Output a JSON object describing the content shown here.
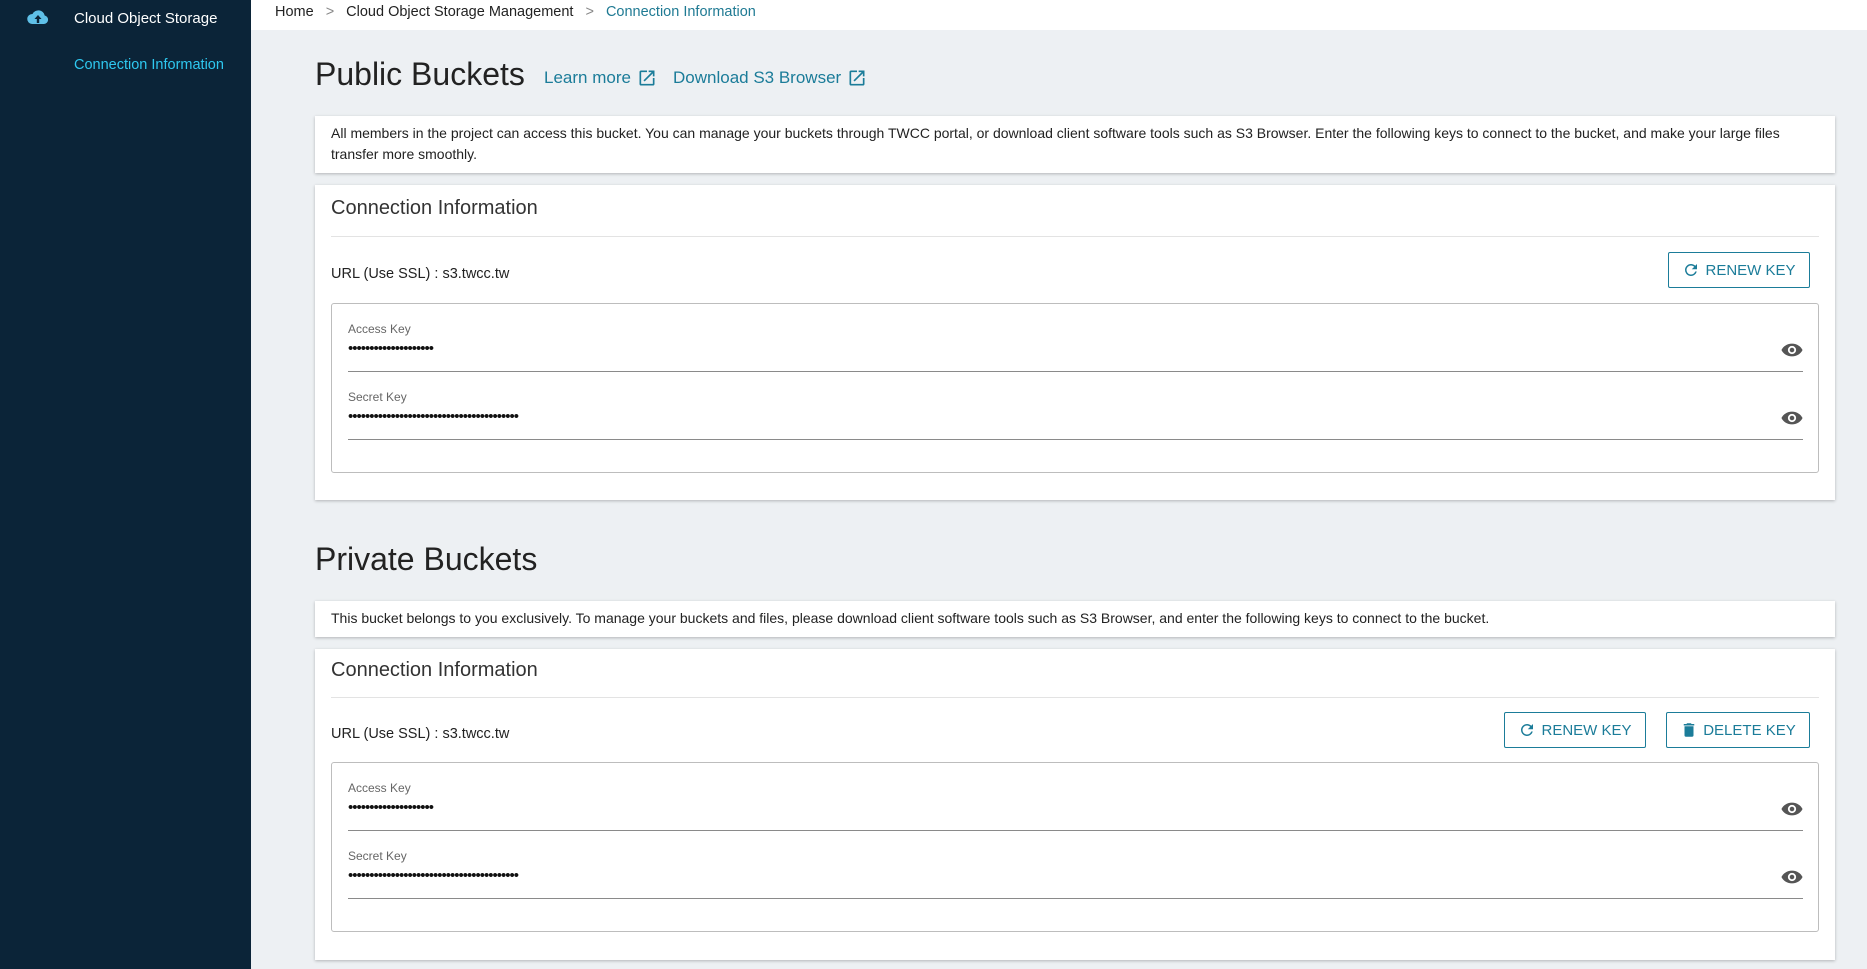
{
  "sidebar": {
    "logo_icon": "cloud-upload-icon",
    "title": "Cloud Object Storage",
    "items": [
      {
        "label": "Connection Information",
        "active": true
      }
    ]
  },
  "breadcrumb": {
    "items": [
      "Home",
      "Cloud Object Storage Management"
    ],
    "separator": ">",
    "current": "Connection Information"
  },
  "public": {
    "title": "Public Buckets",
    "learn_more": "Learn more",
    "download": "Download S3 Browser",
    "description": "All members in the project can access this bucket. You can manage your buckets through TWCC portal, or download client software tools such as S3 Browser. Enter the following keys to connect to the bucket, and make your large files transfer more smoothly.",
    "conn_title": "Connection Information",
    "url": "URL (Use SSL) : s3.twcc.tw",
    "renew_label": "RENEW KEY",
    "access_key_label": "Access Key",
    "access_key_value": "••••••••••••••••••••",
    "secret_key_label": "Secret Key",
    "secret_key_value": "••••••••••••••••••••••••••••••••••••••••"
  },
  "private": {
    "title": "Private Buckets",
    "description": "This bucket belongs to you exclusively. To manage your buckets and files, please download client software tools such as S3 Browser, and enter the following keys to connect to the bucket.",
    "conn_title": "Connection Information",
    "url": "URL (Use SSL) : s3.twcc.tw",
    "renew_label": "RENEW KEY",
    "delete_label": "DELETE KEY",
    "access_key_label": "Access Key",
    "access_key_value": "••••••••••••••••••••",
    "secret_key_label": "Secret Key",
    "secret_key_value": "••••••••••••••••••••••••••••••••••••••••"
  },
  "colors": {
    "sidebar_bg": "#0b2438",
    "accent": "#1b7c99",
    "active_nav": "#2ec8f0"
  }
}
